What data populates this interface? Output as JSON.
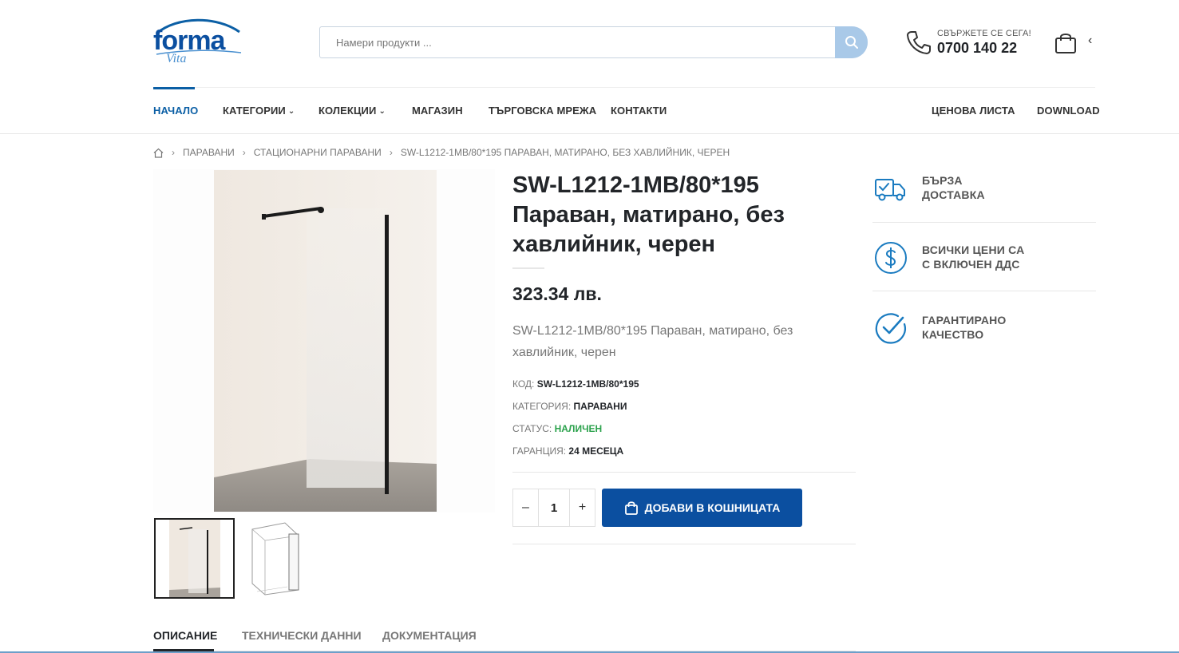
{
  "brand": {
    "logo_text": "forma",
    "logo_sub": "Vita",
    "accent": "#0b5fa5",
    "button_color": "#0b4fa0",
    "status_color": "#2ba24c"
  },
  "search": {
    "placeholder": "Намери продукти ...",
    "icon": "search-icon"
  },
  "contact": {
    "label": "СВЪРЖЕТЕ СЕ СЕГА!",
    "phone": "0700 140 22",
    "icon": "phone-icon"
  },
  "cart": {
    "icon": "shopping-bag-icon",
    "toggle": "‹"
  },
  "nav": {
    "home": "НАЧАЛО",
    "categories": "КАТЕГОРИИ",
    "collections": "КОЛЕКЦИИ",
    "shop": "МАГАЗИН",
    "network": "ТЪРГОВСКА МРЕЖА",
    "contacts": "КОНТАКТИ",
    "pricelist": "ЦЕНОВА ЛИСТА",
    "download": "DOWNLOAD",
    "chevron": "⌄"
  },
  "breadcrumb": {
    "sep": "›",
    "items": [
      "ПАРАВАНИ",
      "СТАЦИОНАРНИ ПАРАВАНИ",
      "SW-L1212-1MB/80*195 ПАРАВАН, МАТИРАНО, БЕЗ ХАВЛИЙНИК, ЧЕРЕН"
    ]
  },
  "product": {
    "title": "SW-L1212-1MB/80*195 Параван, матирано, без хавлийник, черен",
    "price": "323.34 лв.",
    "short_desc": "SW-L1212-1MB/80*195 Параван, матирано, без хавлийник, черен",
    "meta": {
      "code_label": "КОД:",
      "code": "SW-L1212-1MB/80*195",
      "category_label": "КАТЕГОРИЯ:",
      "category": "ПАРАВАНИ",
      "status_label": "СТАТУС:",
      "status": "НАЛИЧЕН",
      "warranty_label": "ГАРАНЦИЯ:",
      "warranty": "24 МЕСЕЦА"
    },
    "quantity": "1",
    "minus": "–",
    "plus": "+",
    "add_to_cart": "ДОБАВИ В КОШНИЦАТА"
  },
  "features": [
    {
      "icon": "delivery-truck-icon",
      "line1": "БЪРЗА",
      "line2": "ДОСТАВКА"
    },
    {
      "icon": "dollar-icon",
      "line1": "ВСИЧКИ ЦЕНИ СА",
      "line2": "С ВКЛЮЧЕН ДДС"
    },
    {
      "icon": "check-circle-icon",
      "line1": "ГАРАНТИРАНО",
      "line2": "КАЧЕСТВО"
    }
  ],
  "tabs": [
    "ОПИСАНИЕ",
    "ТЕХНИЧЕСКИ ДАННИ",
    "ДОКУМЕНТАЦИЯ"
  ]
}
